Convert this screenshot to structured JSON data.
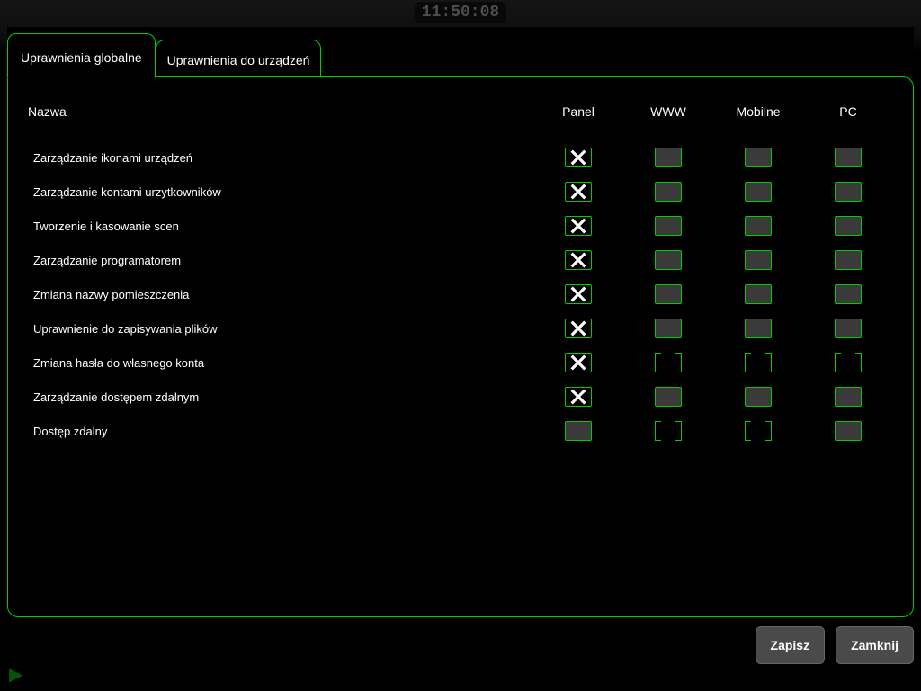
{
  "background_clock": "11:50:08",
  "tabs": {
    "active": "Uprawnienia globalne",
    "inactive": "Uprawnienia do urządzeń"
  },
  "columns": {
    "name": "Nazwa",
    "panel": "Panel",
    "www": "WWW",
    "mobile": "Mobilne",
    "pc": "PC"
  },
  "rows": [
    {
      "name": "Zarządzanie ikonami urządzeń",
      "panel": "checked",
      "www": "empty",
      "mobile": "empty",
      "pc": "empty"
    },
    {
      "name": "Zarządzanie kontami urzytkowników",
      "panel": "checked",
      "www": "empty",
      "mobile": "empty",
      "pc": "empty"
    },
    {
      "name": "Tworzenie i kasowanie scen",
      "panel": "checked",
      "www": "empty",
      "mobile": "empty",
      "pc": "empty"
    },
    {
      "name": "Zarządzanie programatorem",
      "panel": "checked",
      "www": "empty",
      "mobile": "empty",
      "pc": "empty"
    },
    {
      "name": "Zmiana nazwy pomieszczenia",
      "panel": "checked",
      "www": "empty",
      "mobile": "empty",
      "pc": "empty"
    },
    {
      "name": "Uprawnienie do zapisywania plików",
      "panel": "checked",
      "www": "empty",
      "mobile": "empty",
      "pc": "empty"
    },
    {
      "name": "Zmiana hasła do własnego konta",
      "panel": "checked",
      "www": "bracket",
      "mobile": "bracket",
      "pc": "bracket"
    },
    {
      "name": "Zarządzanie dostępem zdalnym",
      "panel": "checked",
      "www": "empty",
      "mobile": "empty",
      "pc": "empty"
    },
    {
      "name": "Dostęp zdalny",
      "panel": "empty",
      "www": "bracket",
      "mobile": "bracket",
      "pc": "empty"
    }
  ],
  "buttons": {
    "save": "Zapisz",
    "close": "Zamknij"
  }
}
